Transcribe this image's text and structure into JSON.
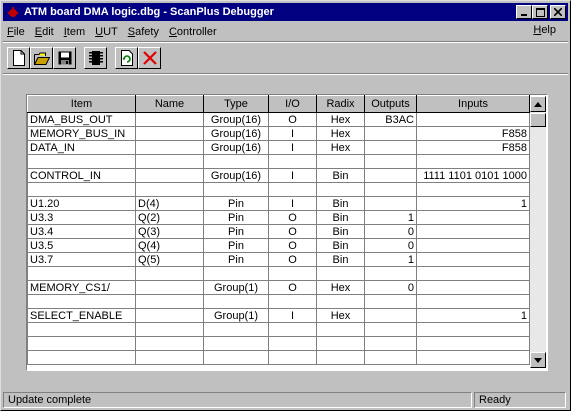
{
  "window": {
    "title": "ATM board DMA logic.dbg - ScanPlus Debugger",
    "controls": [
      "minimize-icon",
      "maximize-icon",
      "close-icon"
    ]
  },
  "menu": {
    "items": [
      {
        "label": "File",
        "accel": "F",
        "rest": "ile"
      },
      {
        "label": "Edit",
        "accel": "E",
        "rest": "dit"
      },
      {
        "label": "Item",
        "accel": "I",
        "rest": "tem"
      },
      {
        "label": "UUT",
        "accel": "U",
        "rest": "UT"
      },
      {
        "label": "Safety",
        "accel": "S",
        "rest": "afety"
      },
      {
        "label": "Controller",
        "accel": "C",
        "rest": "ontroller"
      }
    ],
    "help": {
      "label": "Help",
      "accel": "H",
      "rest": "elp"
    }
  },
  "toolbar": {
    "buttons": [
      "new-file-icon",
      "open-folder-icon",
      "save-disk-icon",
      "chip-icon",
      "refresh-icon",
      "delete-x-icon"
    ]
  },
  "grid": {
    "columns": [
      "Item",
      "Name",
      "Type",
      "I/O",
      "Radix",
      "Outputs",
      "Inputs"
    ],
    "rows": [
      [
        "DMA_BUS_OUT",
        "",
        "Group(16)",
        "O",
        "Hex",
        "B3AC",
        ""
      ],
      [
        "MEMORY_BUS_IN",
        "",
        "Group(16)",
        "I",
        "Hex",
        "",
        "F858"
      ],
      [
        "DATA_IN",
        "",
        "Group(16)",
        "I",
        "Hex",
        "",
        "F858"
      ],
      [
        "",
        "",
        "",
        "",
        "",
        "",
        ""
      ],
      [
        "CONTROL_IN",
        "",
        "Group(16)",
        "I",
        "Bin",
        "",
        "1111 1101 0101 1000"
      ],
      [
        "",
        "",
        "",
        "",
        "",
        "",
        ""
      ],
      [
        "U1.20",
        "D(4)",
        "Pin",
        "I",
        "Bin",
        "",
        "1"
      ],
      [
        "U3.3",
        "Q(2)",
        "Pin",
        "O",
        "Bin",
        "1",
        ""
      ],
      [
        "U3.4",
        "Q(3)",
        "Pin",
        "O",
        "Bin",
        "0",
        ""
      ],
      [
        "U3.5",
        "Q(4)",
        "Pin",
        "O",
        "Bin",
        "0",
        ""
      ],
      [
        "U3.7",
        "Q(5)",
        "Pin",
        "O",
        "Bin",
        "1",
        ""
      ],
      [
        "",
        "",
        "",
        "",
        "",
        "",
        ""
      ],
      [
        "MEMORY_CS1/",
        "",
        "Group(1)",
        "O",
        "Hex",
        "0",
        ""
      ],
      [
        "",
        "",
        "",
        "",
        "",
        "",
        ""
      ],
      [
        "SELECT_ENABLE",
        "",
        "Group(1)",
        "I",
        "Hex",
        "",
        "1"
      ],
      [
        "",
        "",
        "",
        "",
        "",
        "",
        ""
      ],
      [
        "",
        "",
        "",
        "",
        "",
        "",
        ""
      ],
      [
        "",
        "",
        "",
        "",
        "",
        "",
        ""
      ]
    ]
  },
  "status": {
    "message": "Update complete",
    "state": "Ready"
  }
}
